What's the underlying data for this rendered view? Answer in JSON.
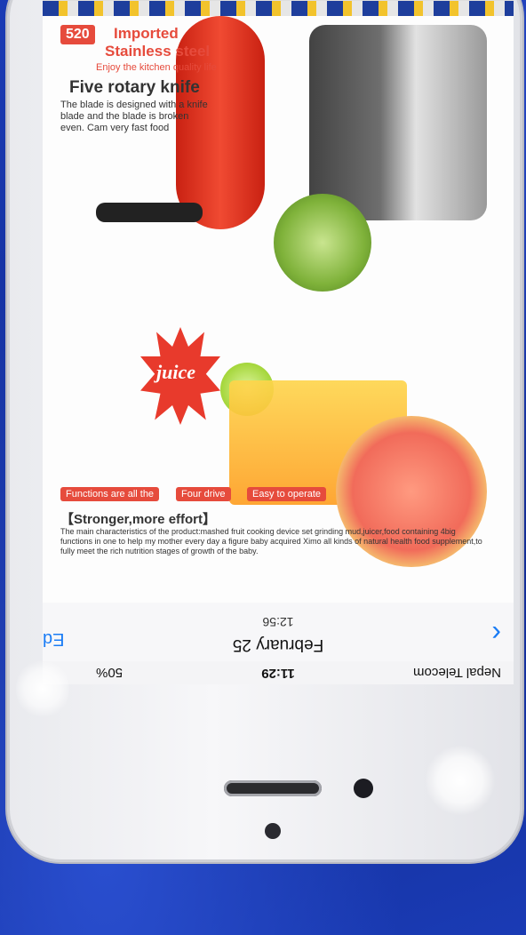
{
  "status_bar": {
    "carrier": "Nepal Telecom",
    "time": "11:29",
    "battery": "50%"
  },
  "nav": {
    "date": "February 25",
    "clock": "12:56",
    "edit": "Edit"
  },
  "poster": {
    "badge_number": "520",
    "headline_1": "Imported",
    "headline_2": "Stainless steel",
    "sub_1": "Enjoy the kitchen quality life",
    "knife_title": "Five rotary knife",
    "knife_desc": "The blade is designed with a knife blade and the blade is broken even. Cam very fast food",
    "juice_label": "juice",
    "tag_1": "Functions are all the",
    "tag_2": "Four drive",
    "tag_3": "Easy to operate",
    "stronger": "【Stronger,more effort】",
    "body_text": "The main characteristics of the product:mashed fruit cooking device set grinding mud,juicer,food containing 4big functions in one to help my mother every day a figure baby acquired Ximo all kinds of natural health food supplement,to fully meet the rich nutrition stages of growth of the baby."
  }
}
